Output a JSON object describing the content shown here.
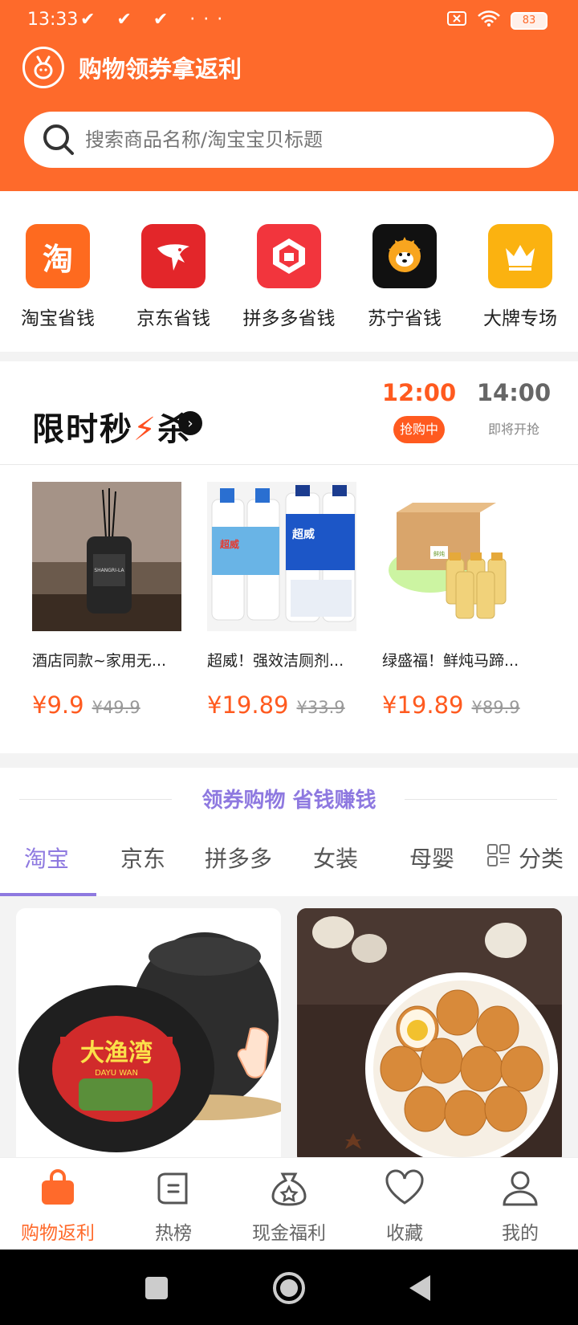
{
  "status_bar": {
    "time": "13:33",
    "notif_icons": "✔ ✔ ✔ ···",
    "battery": "83"
  },
  "app": {
    "title": "购物领券拿返利"
  },
  "search": {
    "placeholder": "搜索商品名称/淘宝宝贝标题"
  },
  "platforms": [
    {
      "label": "淘宝省钱",
      "icon": "taobao-icon",
      "glyph": "淘",
      "color": "#fe6a1f"
    },
    {
      "label": "京东省钱",
      "icon": "jd-icon",
      "glyph": "",
      "color": "#e3262a"
    },
    {
      "label": "拼多多省钱",
      "icon": "pinduoduo-icon",
      "glyph": "",
      "color": "#f2353d"
    },
    {
      "label": "苏宁省钱",
      "icon": "suning-icon",
      "glyph": "",
      "color": "#111111"
    },
    {
      "label": "大牌专场",
      "icon": "crown-icon",
      "glyph": "",
      "color": "#fbb210"
    }
  ],
  "flash_sale": {
    "title_a": "限时秒",
    "title_b": "杀",
    "arrow": "›",
    "slots": [
      {
        "time": "12:00",
        "status": "抢购中",
        "active": true
      },
      {
        "time": "14:00",
        "status": "即将开抢",
        "active": false
      }
    ],
    "deals": [
      {
        "name": "酒店同款~家用无...",
        "price": "¥9.9",
        "original": "¥49.9"
      },
      {
        "name": "超威！强效洁厕剂...",
        "price": "¥19.89",
        "original": "¥33.9"
      },
      {
        "name": "绿盛福！鲜炖马蹄...",
        "price": "¥19.89",
        "original": "¥89.9"
      }
    ],
    "deal_labels": {
      "diffuser": "SHANGRI-LA",
      "cleaner_brand": "超威",
      "box_text": "鲜炖"
    }
  },
  "coupon": {
    "heading": "领券购物 省钱赚钱",
    "tabs": [
      "淘宝",
      "京东",
      "拼多多",
      "女装",
      "母婴"
    ],
    "category_label": "分类"
  },
  "products": {
    "seaweed_brand": "大渔湾",
    "seaweed_sub": "DAYU WAN"
  },
  "bottom_nav": [
    {
      "label": "购物返利",
      "active": true
    },
    {
      "label": "热榜",
      "active": false
    },
    {
      "label": "现金福利",
      "active": false
    },
    {
      "label": "收藏",
      "active": false
    },
    {
      "label": "我的",
      "active": false
    }
  ],
  "colors": {
    "brand": "#fe6a2b",
    "accent": "#8e79e0",
    "price": "#ff5a1f"
  }
}
